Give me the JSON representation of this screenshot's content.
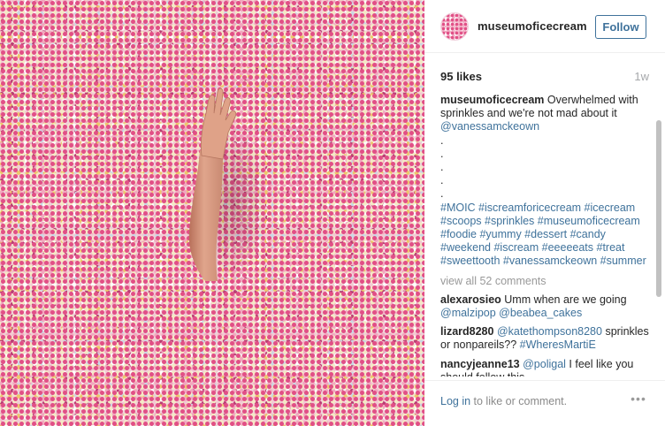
{
  "post": {
    "image_alt": "Mannequin arm rising out of a pool of pastel sprinkles",
    "colors": {
      "pink": "#e14f86",
      "cream": "#f5e9c6",
      "blush": "#f2a7bf",
      "yellow": "#eec86a",
      "blue": "#c9d8e6"
    }
  },
  "header": {
    "username": "museumoficecream",
    "follow_label": "Follow"
  },
  "stats": {
    "likes": "95 likes",
    "age": "1w"
  },
  "caption": {
    "username": "museumoficecream",
    "text": " Overwhelmed with sprinkles and we're not mad about it ",
    "mention": "@vanessamckeown",
    "dots": [
      ".",
      ".",
      ".",
      ".",
      "."
    ],
    "hashtags": "#MOIC #iscreamforicecream #icecream #scoops #sprinkles #museumoficecream #foodie #yummy #dessert #candy #weekend #iscream #eeeeeats #treat #sweettooth #vanessamckeown #summer"
  },
  "view_all_label": "view all 52 comments",
  "comments": [
    {
      "user": "alexarosieo",
      "text": " Umm when are we going ",
      "mentions": "@malzipop @beabea_cakes"
    },
    {
      "user": "lizard8280",
      "mention_before": " @katethompson8280",
      "text": " sprinkles or nonpareils?? ",
      "mentions": "#WheresMartiE"
    },
    {
      "user": "nancyjeanne13",
      "mention_before": " @poligal",
      "text": " I feel like you should follow this",
      "mentions": ""
    }
  ],
  "footer": {
    "login_label": "Log in",
    "text": " to like or comment.",
    "more_icon": "more-options-icon",
    "more_glyph": "•••"
  }
}
